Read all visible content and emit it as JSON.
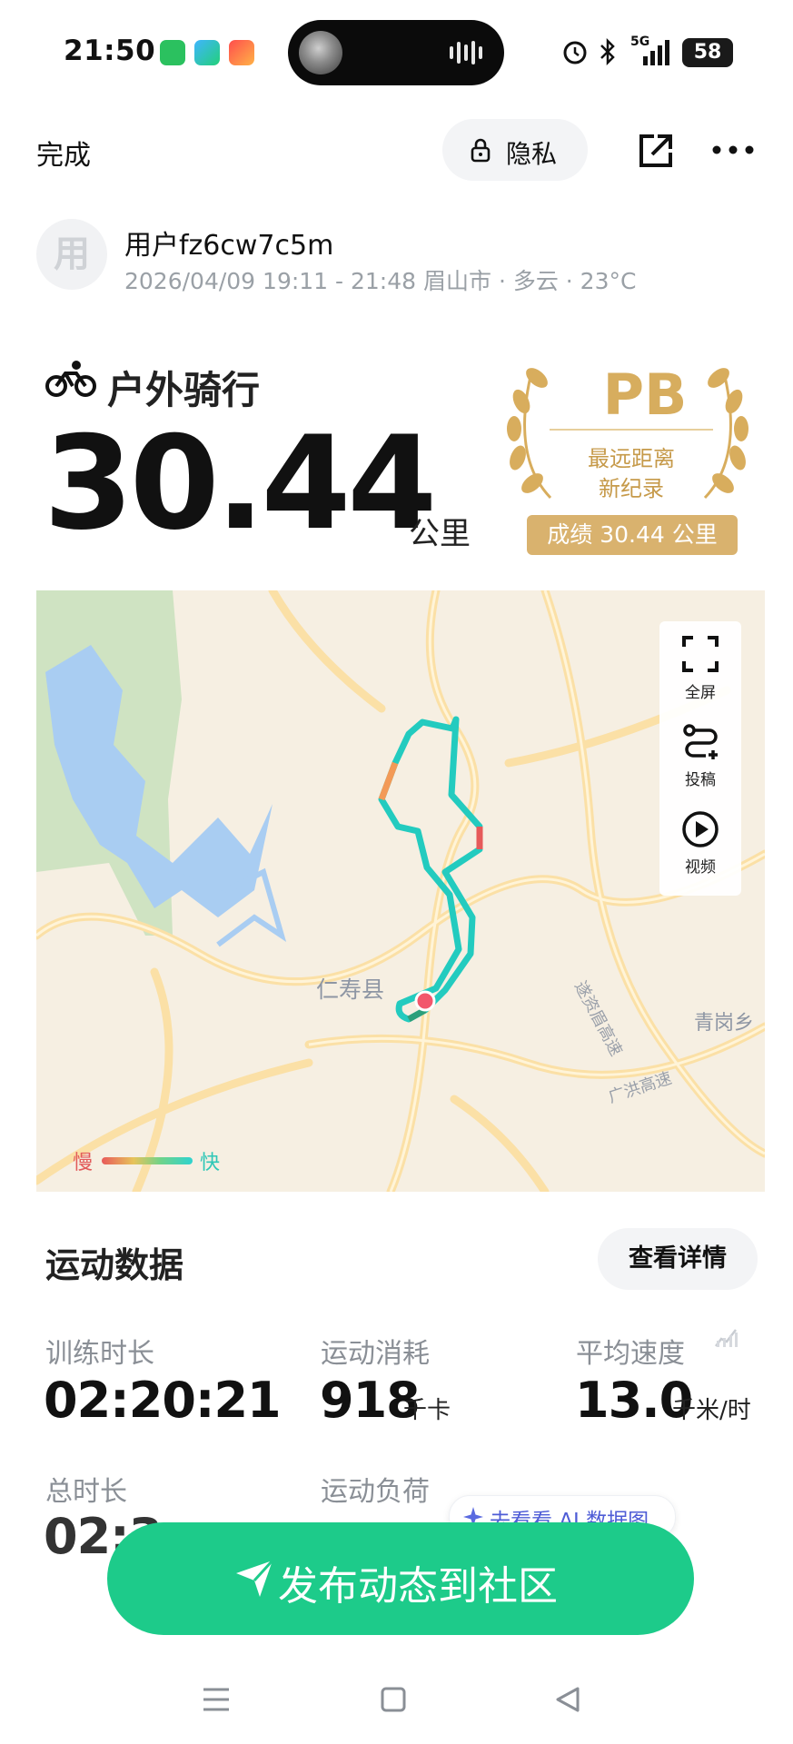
{
  "status_bar": {
    "time": "21:50",
    "network": "5G",
    "battery": "58",
    "icons": [
      "wechat-icon",
      "tv-app-icon",
      "game-app-icon",
      "alarm-icon",
      "bluetooth-icon",
      "signal-icon"
    ]
  },
  "header": {
    "done_label": "完成",
    "privacy_label": "隐私",
    "icons": [
      "lock-icon",
      "share-icon",
      "more-icon"
    ]
  },
  "user": {
    "avatar_text": "用",
    "name": "用户fz6cw7c5m",
    "meta": "2026/04/09 19:11 - 21:48 眉山市 · 多云 · 23°C"
  },
  "activity": {
    "type": "户外骑行",
    "distance": "30.44",
    "unit": "公里",
    "badge": {
      "title": "PB",
      "line1": "最远距离",
      "line2": "新纪录",
      "record": "成绩 30.44 公里"
    }
  },
  "map": {
    "labels": {
      "county": "仁寿县",
      "town": "青岗乡",
      "highway_1": "遂资眉高速",
      "highway_2": "广洪高速"
    },
    "tools": [
      {
        "label": "全屏",
        "icon": "fullscreen-icon"
      },
      {
        "label": "投稿",
        "icon": "route-submit-icon"
      },
      {
        "label": "视频",
        "icon": "play-video-icon"
      }
    ],
    "legend": {
      "slow": "慢",
      "fast": "快"
    }
  },
  "stats": {
    "title": "运动数据",
    "detail_label": "查看详情",
    "items": [
      {
        "label": "训练时长",
        "value": "02:20:21",
        "unit": ""
      },
      {
        "label": "运动消耗",
        "value": "918",
        "unit": "千卡"
      },
      {
        "label": "平均速度",
        "value": "13.0",
        "unit": "千米/时"
      },
      {
        "label": "总时长",
        "value": "02:3",
        "unit": ""
      },
      {
        "label": "运动负荷",
        "value": "",
        "unit": ""
      }
    ],
    "ai_label": "去看看 AI 数据图"
  },
  "post_button": {
    "label": "发布动态到社区"
  },
  "nav": {
    "icons": [
      "menu-nav-icon",
      "home-nav-icon",
      "back-nav-icon"
    ]
  }
}
